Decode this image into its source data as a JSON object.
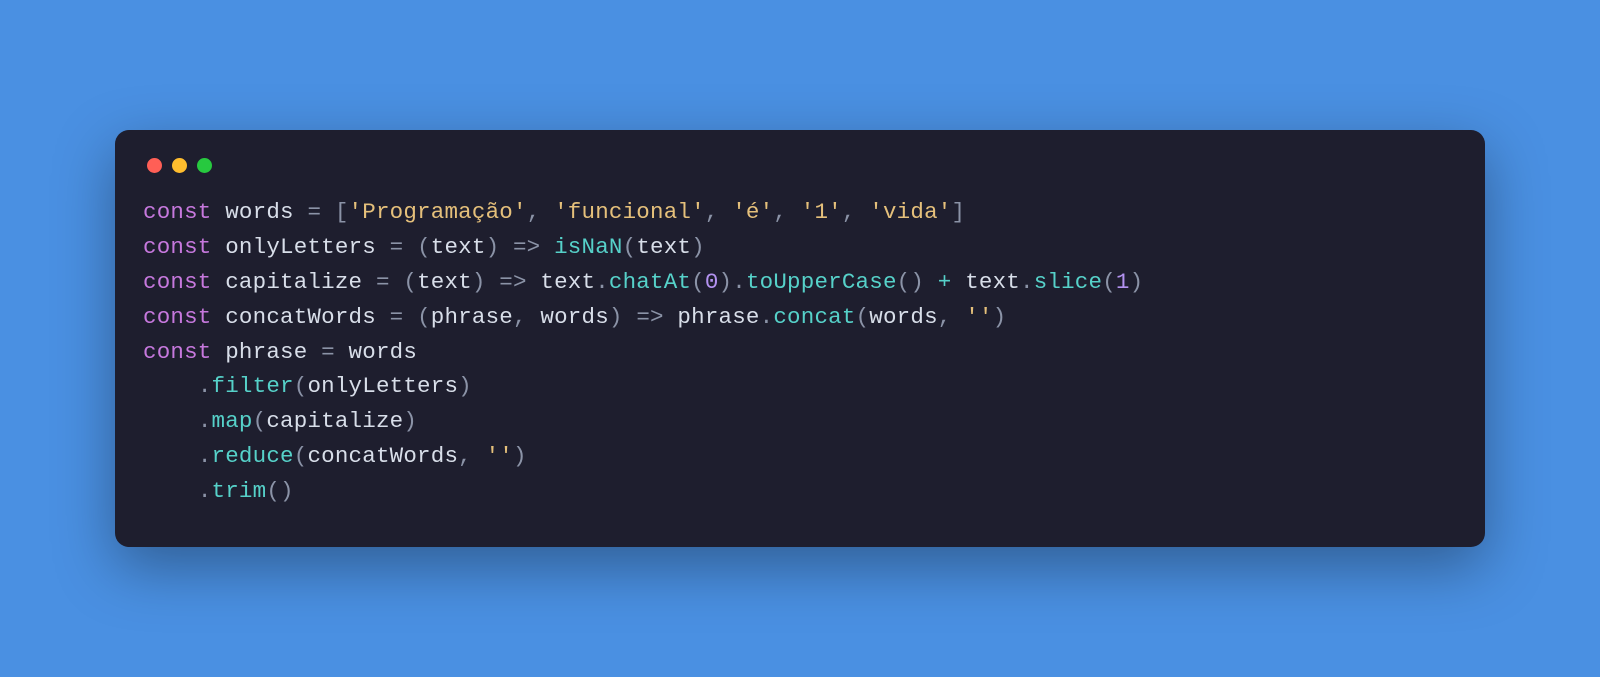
{
  "colors": {
    "background": "#4a90e2",
    "window": "#1e1e2e",
    "dots": {
      "red": "#ff5f56",
      "yellow": "#ffbd2e",
      "green": "#27c93f"
    },
    "keyword": "#c678dd",
    "default": "#d8dee9",
    "punctuation": "#8b93a7",
    "string": "#e5c07b",
    "function": "#56d1c9",
    "number": "#b392f0"
  },
  "code": {
    "l1": {
      "kw": "const",
      "name": " words ",
      "eq": "= ",
      "lbracket": "[",
      "s1": "'Programação'",
      "s2": "'funcional'",
      "s3": "'é'",
      "s4": "'1'",
      "s5": "'vida'",
      "comma": ", ",
      "rbracket": "]"
    },
    "l2": {
      "kw": "const",
      "name": " onlyLetters ",
      "eq": "= ",
      "lp": "(",
      "param": "text",
      "rp": ") ",
      "arrow": "=>",
      "sp": " ",
      "fn": "isNaN",
      "lp2": "(",
      "arg": "text",
      "rp2": ")"
    },
    "l3": {
      "kw": "const",
      "name": " capitalize ",
      "eq": "= ",
      "lp": "(",
      "param": "text",
      "rp": ") ",
      "arrow": "=>",
      "sp": " ",
      "obj1": "text",
      "dot1": ".",
      "m1": "chatAt",
      "lp2": "(",
      "n1": "0",
      "rp2": ")",
      "dot2": ".",
      "m2": "toUpperCase",
      "lp3": "(",
      "rp3": ")",
      "plus": " + ",
      "obj2": "text",
      "dot3": ".",
      "m3": "slice",
      "lp4": "(",
      "n2": "1",
      "rp4": ")"
    },
    "l4": {
      "kw": "const",
      "name": " concatWords ",
      "eq": "= ",
      "lp": "(",
      "p1": "phrase",
      "comma": ", ",
      "p2": "words",
      "rp": ") ",
      "arrow": "=>",
      "sp": " ",
      "obj": "phrase",
      "dot": ".",
      "m": "concat",
      "lp2": "(",
      "a1": "words",
      "comma2": ", ",
      "s1": "''",
      "rp2": ")"
    },
    "l5": {
      "kw": "const",
      "name": " phrase ",
      "eq": "= ",
      "rhs": "words"
    },
    "l6": {
      "indent": "    ",
      "dot": ".",
      "m": "filter",
      "lp": "(",
      "arg": "onlyLetters",
      "rp": ")"
    },
    "l7": {
      "indent": "    ",
      "dot": ".",
      "m": "map",
      "lp": "(",
      "arg": "capitalize",
      "rp": ")"
    },
    "l8": {
      "indent": "    ",
      "dot": ".",
      "m": "reduce",
      "lp": "(",
      "arg": "concatWords",
      "comma": ", ",
      "s": "''",
      "rp": ")"
    },
    "l9": {
      "indent": "    ",
      "dot": ".",
      "m": "trim",
      "lp": "(",
      "rp": ")"
    }
  }
}
